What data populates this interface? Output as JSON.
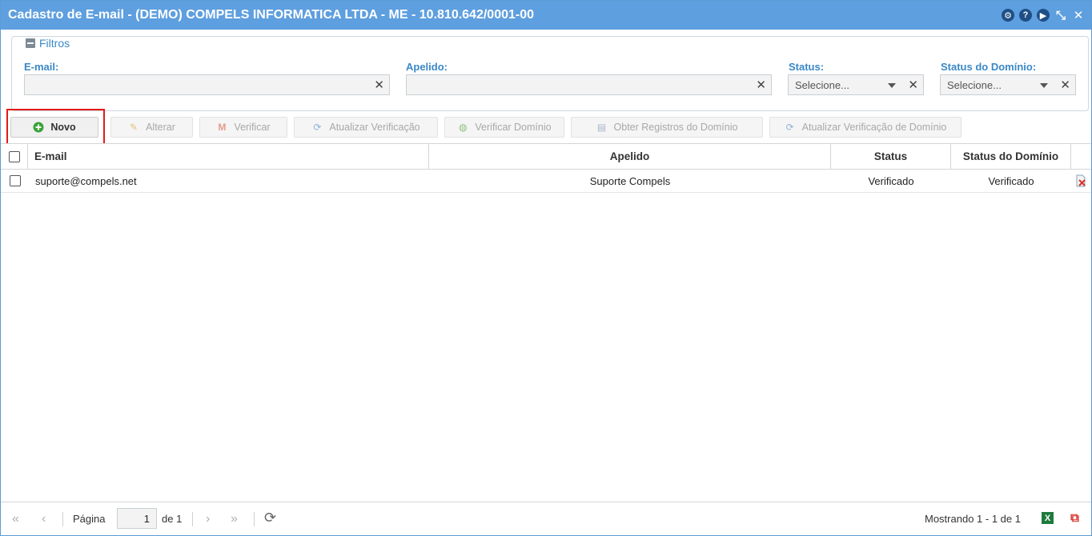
{
  "window": {
    "title": "Cadastro de E-mail - (DEMO) COMPELS INFORMATICA LTDA - ME - 10.810.642/0001-00",
    "icons": [
      "settings-icon",
      "help-icon",
      "play-icon",
      "collapse-window-icon",
      "close-icon"
    ]
  },
  "filters": {
    "legend": "Filtros",
    "email_label": "E-mail:",
    "email_value": "",
    "apelido_label": "Apelido:",
    "apelido_value": "",
    "status_label": "Status:",
    "status_value": "Selecione...",
    "status_dominio_label": "Status do Domínio:",
    "status_dominio_value": "Selecione...",
    "clear_glyph": "✕"
  },
  "toolbar": {
    "novo": "Novo",
    "alterar": "Alterar",
    "verificar": "Verificar",
    "atualizar_verificacao": "Atualizar Verificação",
    "verificar_dominio": "Verificar Domínio",
    "obter_registros": "Obter Registros do Domínio",
    "atualizar_verificacao_dominio": "Atualizar Verificação de Domínio"
  },
  "grid": {
    "columns": [
      "E-mail",
      "Apelido",
      "Status",
      "Status do Domínio"
    ],
    "rows": [
      {
        "email": "suporte@compels.net",
        "apelido": "Suporte Compels",
        "status": "Verificado",
        "status_dominio": "Verificado"
      }
    ]
  },
  "pager": {
    "page_label": "Página",
    "page_value": "1",
    "of_label": "de 1",
    "summary": "Mostrando 1 - 1 de 1"
  },
  "colors": {
    "titlebar": "#5e9fdf",
    "accent_label": "#3a88c7",
    "highlight": "#e31919"
  }
}
